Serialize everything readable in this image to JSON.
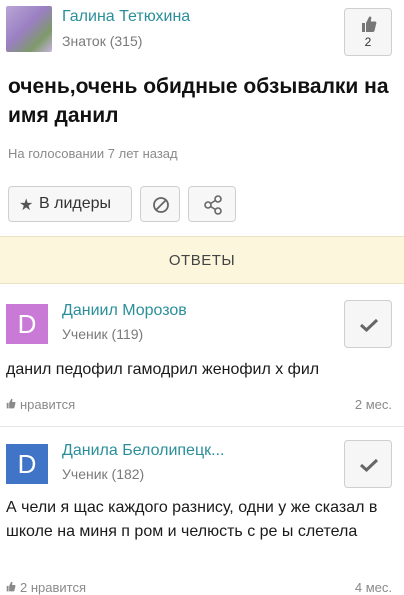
{
  "question": {
    "author_name": "Галина Тетюхина",
    "author_rank": "Знаток (315)",
    "likes": "2",
    "title": "очень,очень обидные обзывалки на имя данил",
    "meta": "На голосовании 7 лет назад",
    "leaders_label": "В лидеры",
    "answers_label": "ОТВЕТЫ"
  },
  "answers": [
    {
      "avatar_letter": "D",
      "author_name": "Даниил Морозов",
      "author_rank": "Ученик (119)",
      "text": "данил педофил гамодрил женофил х  фил",
      "likes_label": "нравится",
      "time": "2 мес."
    },
    {
      "avatar_letter": "D",
      "author_name": "Данила Белолипецк...",
      "author_rank": "Ученик (182)",
      "text": "А  чели я щас каждого разнису, одни у же сказал в школе на миня п   ром и челюсть с ре   ы слетела",
      "likes_label": "2 нравится",
      "time": "4 мес."
    }
  ],
  "colors": {
    "name": "#2a8f9a",
    "answers_band": "#fbf6dc",
    "avatar_1": "#c97ad6",
    "avatar_2": "#3f74c6"
  },
  "icons": [
    "thumbs-up-icon",
    "star-icon",
    "block-icon",
    "share-icon",
    "check-icon"
  ]
}
